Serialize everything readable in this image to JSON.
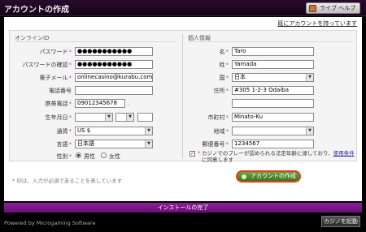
{
  "window": {
    "title": "アカウントの作成"
  },
  "help_button": {
    "label": "ライブ ヘルプ",
    "icon": "person-icon"
  },
  "have_account_link": "既にアカウントを持っています",
  "left": {
    "section_title": "オンラインID",
    "password": {
      "label": "パスワード",
      "value": "●●●●●●●●●●●"
    },
    "password_confirm": {
      "label": "パスワードの確認",
      "value": "●●●●●●●●●●●"
    },
    "email": {
      "label": "電子メール",
      "value": "onlinecasino@kurabu.com"
    },
    "phone": {
      "label": "電話番号",
      "value": ""
    },
    "mobile": {
      "label": "携帯電話",
      "value": "09012345678"
    },
    "birth": {
      "label": "生年月日",
      "year": "",
      "month": "",
      "day": ""
    },
    "currency": {
      "label": "通貨",
      "value": "US $"
    },
    "language": {
      "label": "言語",
      "value": "日本語"
    },
    "gender": {
      "label": "性別",
      "male": "男性",
      "female": "女性",
      "selected": "male"
    }
  },
  "right": {
    "section_title": "個人情報",
    "first_name": {
      "label": "名",
      "value": "Taro"
    },
    "last_name": {
      "label": "姓",
      "value": "Yamada"
    },
    "country": {
      "label": "国",
      "value": "日本"
    },
    "address": {
      "label": "住所",
      "value": "#305 1-2-3 Odaiba",
      "value2": ""
    },
    "city": {
      "label": "市町村",
      "value": "Minato-Ku"
    },
    "region": {
      "label": "地域",
      "value": ""
    },
    "postal": {
      "label": "郵便番号",
      "value": "1234567"
    },
    "terms": {
      "text_1": "カジノでのプレーが認められる法定年齢に達しており、",
      "link": "使用条件",
      "text_2": "に同意します",
      "checked": true
    }
  },
  "required_note": "印は、入力が必須であることを表しています",
  "create_button": "アカウントの作成",
  "install_bar": "インストールの完了",
  "powered_by": "Powered by Microgaming Software",
  "restart_button": "カジノを起動",
  "colors": {
    "accent": "#7a1488",
    "button_green": "#4f8c2e",
    "button_ring": "#e04020"
  }
}
